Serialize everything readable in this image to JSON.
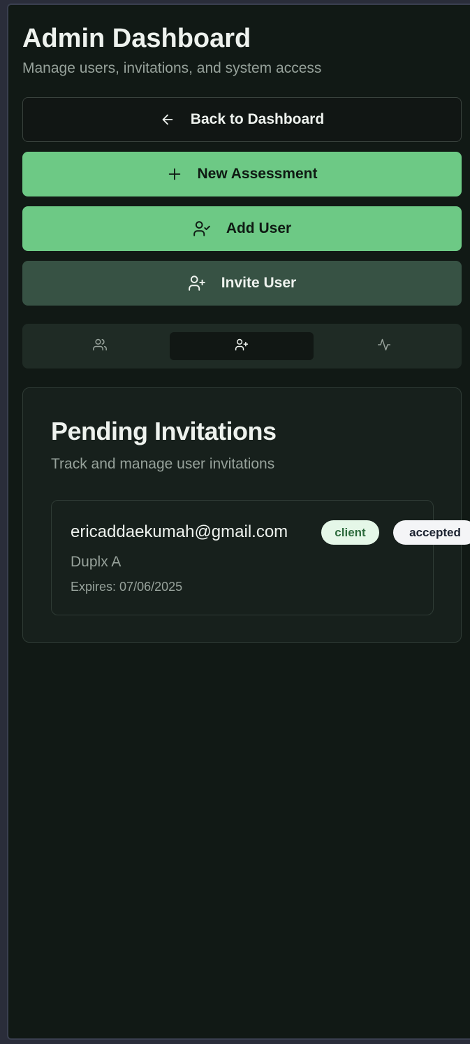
{
  "header": {
    "title": "Admin Dashboard",
    "subtitle": "Manage users, invitations, and system access"
  },
  "actions": {
    "back_label": "Back to Dashboard",
    "back_icon": "arrow-left-icon",
    "new_assessment_label": "New Assessment",
    "new_assessment_icon": "plus-icon",
    "add_user_label": "Add User",
    "add_user_icon": "user-check-icon",
    "invite_user_label": "Invite User",
    "invite_user_icon": "user-plus-icon"
  },
  "tabs": [
    {
      "icon": "users-icon",
      "active": false
    },
    {
      "icon": "user-plus-icon",
      "active": true
    },
    {
      "icon": "activity-icon",
      "active": false
    }
  ],
  "invitations": {
    "title": "Pending Invitations",
    "subtitle": "Track and manage user invitations",
    "items": [
      {
        "email": "ericaddaekumah@gmail.com",
        "role": "client",
        "status": "accepted",
        "name": "Duplx A",
        "expires_label": "Expires:",
        "expires_date": "07/06/2025"
      }
    ]
  },
  "colors": {
    "background": "#111915",
    "accent_green": "#6dc985",
    "invite_button": "#375244",
    "badge_role_bg": "#e5f7e8",
    "badge_status_bg": "#f4f5f7"
  }
}
